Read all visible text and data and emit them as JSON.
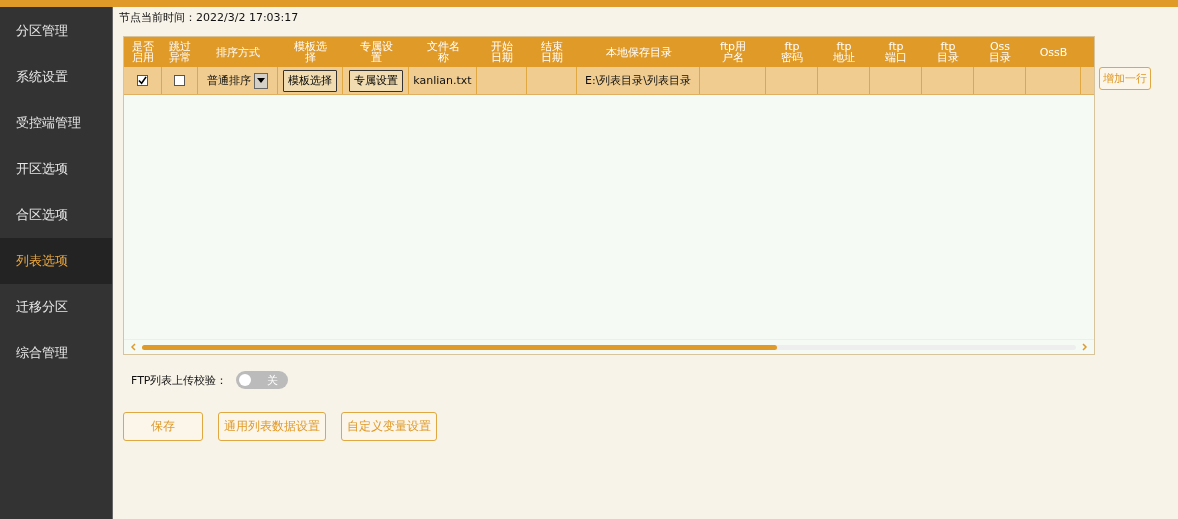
{
  "sidebar": {
    "items": [
      {
        "label": "分区管理",
        "selected": false
      },
      {
        "label": "系统设置",
        "selected": false
      },
      {
        "label": "受控端管理",
        "selected": false
      },
      {
        "label": "开区选项",
        "selected": false
      },
      {
        "label": "合区选项",
        "selected": false
      },
      {
        "label": "列表选项",
        "selected": true
      },
      {
        "label": "迁移分区",
        "selected": false
      },
      {
        "label": "综合管理",
        "selected": false
      }
    ]
  },
  "node_time": "节点当前时间：2022/3/2 17:03:17",
  "table": {
    "columns": [
      "是否启用",
      "跳过异常",
      "排序方式",
      "模板选择",
      "专属设置",
      "文件名称",
      "开始日期",
      "结束日期",
      "本地保存目录",
      "ftp用户名",
      "ftp密码",
      "ftp地址",
      "ftp端口",
      "ftp目录",
      "Oss目录",
      "OssB"
    ],
    "rows": [
      {
        "cells": [
          {
            "kind": "checkbox",
            "checked": true
          },
          {
            "kind": "checkbox",
            "checked": false
          },
          {
            "kind": "dropdown",
            "value": "普通排序"
          },
          {
            "kind": "button",
            "text": "模板选择"
          },
          {
            "kind": "button",
            "text": "专属设置"
          },
          {
            "kind": "text",
            "text": "kanlian.txt"
          },
          {
            "kind": "empty"
          },
          {
            "kind": "empty"
          },
          {
            "kind": "text",
            "text": "E:\\列表目录\\列表目录"
          },
          {
            "kind": "empty"
          },
          {
            "kind": "empty"
          },
          {
            "kind": "empty"
          },
          {
            "kind": "empty"
          },
          {
            "kind": "empty"
          },
          {
            "kind": "empty"
          },
          {
            "kind": "empty"
          }
        ]
      }
    ]
  },
  "add_row_button": "增加一行",
  "ftp_check": {
    "label": "FTP列表上传校验：",
    "on": false,
    "state_text": "关"
  },
  "buttons": [
    "保存",
    "通用列表数据设置",
    "自定义变量设置"
  ]
}
